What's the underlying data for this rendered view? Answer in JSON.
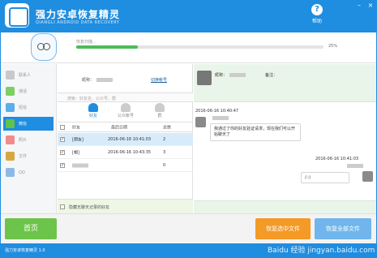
{
  "app": {
    "title": "强力安卓恢复精灵",
    "subtitle": "QIANGLI ANDROID DATA RECOVERY",
    "help_label": "帮助",
    "help_icon": "?",
    "minimize_icon": "–",
    "close_icon": "×",
    "brand_color": "#1f8de0"
  },
  "scan": {
    "label": "恢复扫描...",
    "progress_percent": 25,
    "progress_text": "25%"
  },
  "sidebar": {
    "items": [
      {
        "label": "联系人",
        "icon": "contacts-icon",
        "color": "#c9c9c9"
      },
      {
        "label": "通话",
        "icon": "call-log-icon",
        "color": "#7ccf62"
      },
      {
        "label": "短信",
        "icon": "messages-icon",
        "color": "#5aaee8"
      },
      {
        "label": "微信",
        "icon": "wechat-icon",
        "color": "#62c24a"
      },
      {
        "label": "照片",
        "icon": "photos-icon",
        "color": "#f28a8a"
      },
      {
        "label": "文件",
        "icon": "files-icon",
        "color": "#d8a640"
      },
      {
        "label": "QQ",
        "icon": "qq-icon",
        "color": "#8db9e6"
      }
    ],
    "active_index": 3
  },
  "account": {
    "nick_label": "昵称：",
    "name_label": "切换帐号"
  },
  "search": {
    "placeholder": "搜索：好友名、公众号、群"
  },
  "tabs": [
    {
      "label": "好友",
      "icon": "friend-icon"
    },
    {
      "label": "公众帐号",
      "icon": "official-account-icon"
    },
    {
      "label": "群",
      "icon": "group-icon"
    }
  ],
  "table": {
    "headers": [
      "好友",
      "最后日期",
      "总数"
    ],
    "rows": [
      {
        "friend": "[朋友]",
        "date": "2016-06-16 10:41:03",
        "count": "2",
        "checked": true,
        "selected": true
      },
      {
        "friend": "[帽]",
        "date": "2016-06-16 10:43:35",
        "count": "3",
        "checked": true,
        "selected": false
      },
      {
        "friend": "",
        "date": "",
        "count": "0",
        "checked": true,
        "selected": false
      }
    ]
  },
  "hide_no_record_label": "隐藏无聊天记录的好友",
  "chat": {
    "nick_label": "昵称：",
    "remark_label": "备注：",
    "messages": [
      {
        "time": "2016-06-16 10:40:47",
        "text": "我通过了你的好友验证请求，现在我们可以开始聊天了",
        "side": "left"
      },
      {
        "time": "2016-06-16 10:41:03",
        "text": "/::)",
        "side": "right"
      }
    ]
  },
  "buttons": {
    "home": "首页",
    "recover_selected": "恢复选中文件",
    "recover_all": "恢复全部文件"
  },
  "status_bar": {
    "version": "强力安卓恢复精灵 1.0"
  },
  "watermark": "Baidu 经验 jingyan.baidu.com"
}
